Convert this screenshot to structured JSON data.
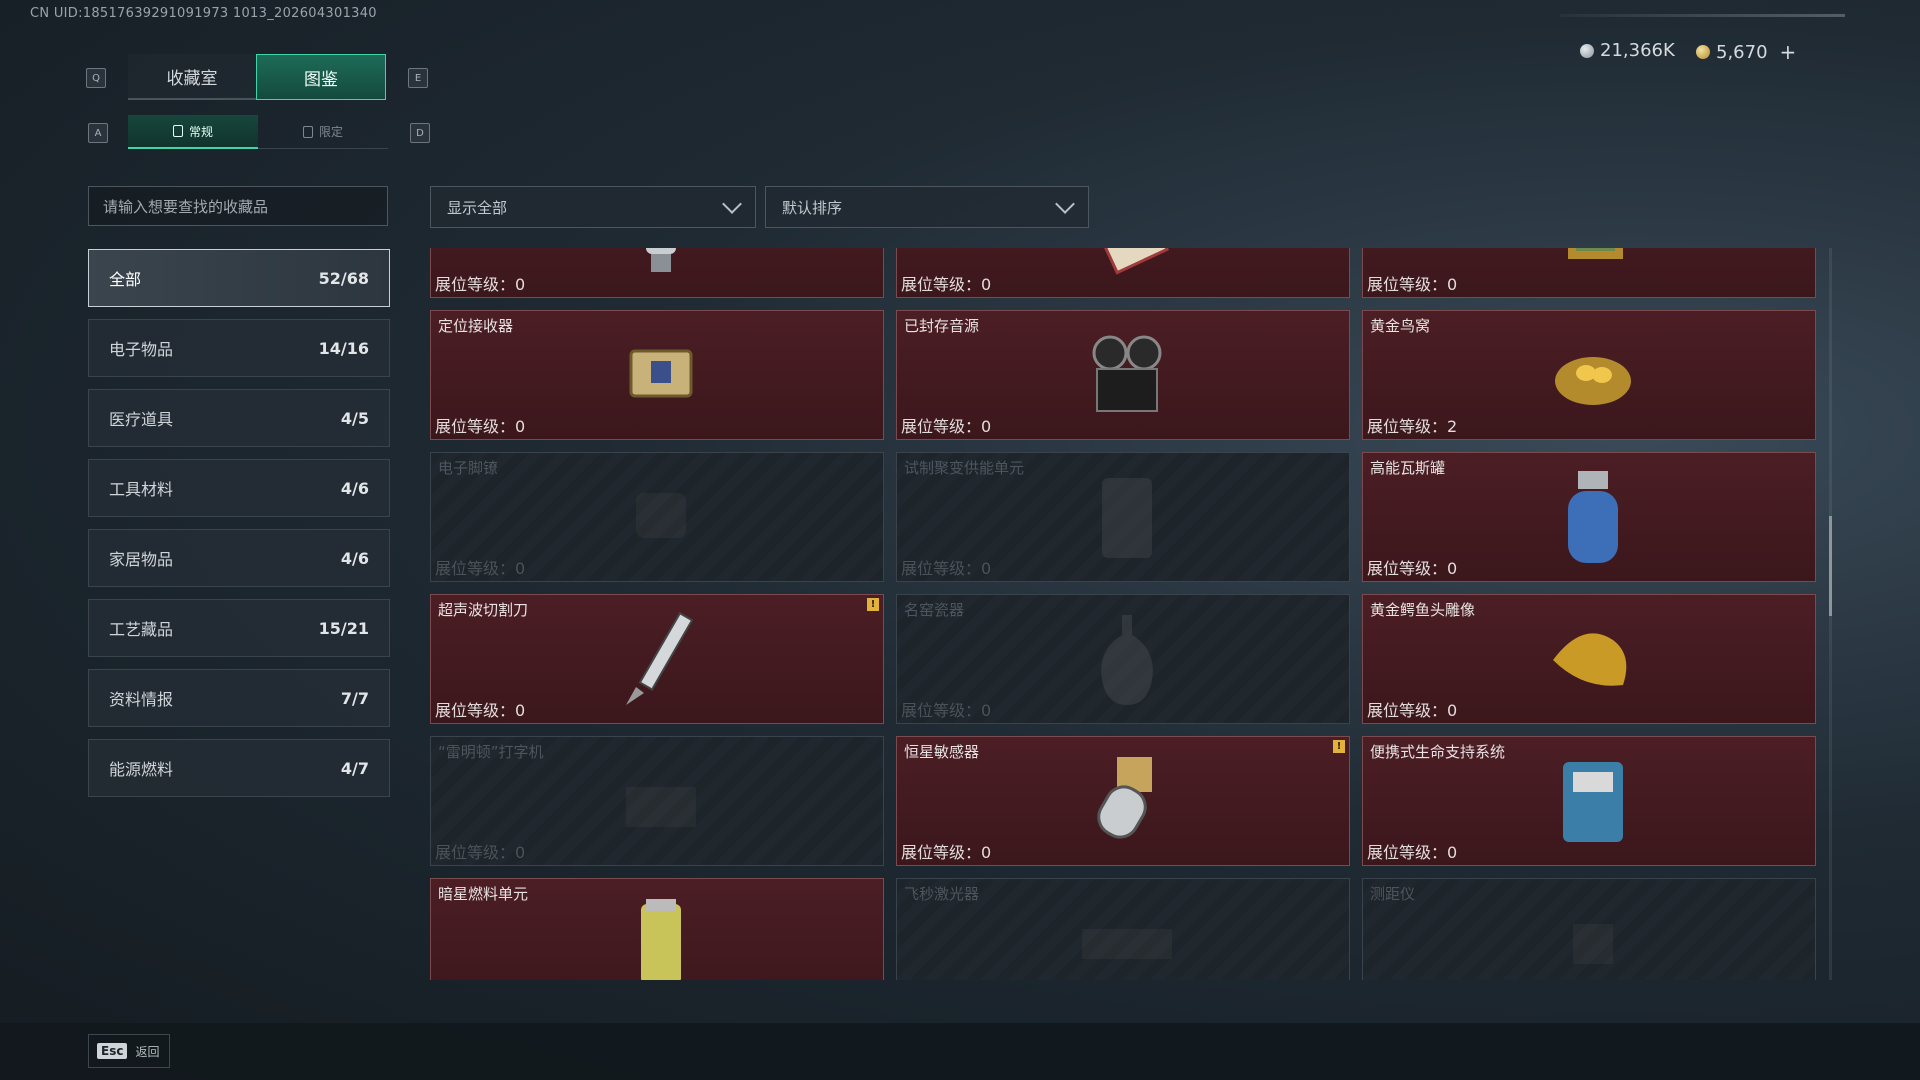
{
  "header": {
    "uid": "CN UID:18517639291091973 1013_202604301340",
    "currency_silver": "21,366K",
    "currency_gold": "5,670",
    "plus_label": "+"
  },
  "keys": {
    "q": "Q",
    "e": "E",
    "a": "A",
    "d": "D"
  },
  "tabs": [
    {
      "label": "收藏室",
      "active": false
    },
    {
      "label": "图鉴",
      "active": true
    }
  ],
  "subtabs": [
    {
      "label": "常规",
      "active": true
    },
    {
      "label": "限定",
      "active": false
    }
  ],
  "search": {
    "placeholder": "请输入想要查找的收藏品"
  },
  "filters": {
    "show": "显示全部",
    "sort": "默认排序"
  },
  "categories": [
    {
      "label": "全部",
      "count": "52/68",
      "active": true
    },
    {
      "label": "电子物品",
      "count": "14/16"
    },
    {
      "label": "医疗道具",
      "count": "4/5"
    },
    {
      "label": "工具材料",
      "count": "4/6"
    },
    {
      "label": "家居物品",
      "count": "4/6"
    },
    {
      "label": "工艺藏品",
      "count": "15/21"
    },
    {
      "label": "资料情报",
      "count": "7/7"
    },
    {
      "label": "能源燃料",
      "count": "4/7"
    }
  ],
  "level_prefix": "展位等级：",
  "items": [
    {
      "name": "",
      "level": "0",
      "unlocked": true,
      "icon": "lock-tool-icon"
    },
    {
      "name": "",
      "level": "0",
      "unlocked": true,
      "icon": "map-scroll-icon"
    },
    {
      "name": "",
      "level": "0",
      "unlocked": true,
      "icon": "framed-painting-icon"
    },
    {
      "name": "定位接收器",
      "level": "0",
      "unlocked": true,
      "icon": "receiver-icon"
    },
    {
      "name": "已封存音源",
      "level": "0",
      "unlocked": true,
      "icon": "reel-recorder-icon"
    },
    {
      "name": "黄金鸟窝",
      "level": "2",
      "unlocked": true,
      "icon": "golden-nest-icon"
    },
    {
      "name": "电子脚镣",
      "level": "0",
      "unlocked": false,
      "icon": "ankle-monitor-icon"
    },
    {
      "name": "试制聚变供能单元",
      "level": "0",
      "unlocked": false,
      "icon": "fusion-unit-icon"
    },
    {
      "name": "高能瓦斯罐",
      "level": "0",
      "unlocked": true,
      "icon": "gas-canister-icon"
    },
    {
      "name": "超声波切割刀",
      "level": "0",
      "unlocked": true,
      "icon": "ultrasonic-knife-icon",
      "badge": "!"
    },
    {
      "name": "名窑瓷器",
      "level": "0",
      "unlocked": false,
      "icon": "porcelain-vase-icon"
    },
    {
      "name": "黄金鳄鱼头雕像",
      "level": "0",
      "unlocked": true,
      "icon": "gold-crocodile-icon"
    },
    {
      "name": "“雷明顿”打字机",
      "level": "0",
      "unlocked": false,
      "icon": "typewriter-icon"
    },
    {
      "name": "恒星敏感器",
      "level": "0",
      "unlocked": true,
      "icon": "star-sensor-icon",
      "badge": "!"
    },
    {
      "name": "便携式生命支持系统",
      "level": "0",
      "unlocked": true,
      "icon": "life-support-icon"
    },
    {
      "name": "暗星燃料单元",
      "level": "",
      "unlocked": true,
      "icon": "fuel-cell-icon"
    },
    {
      "name": "飞秒激光器",
      "level": "",
      "unlocked": false,
      "icon": "laser-icon"
    },
    {
      "name": "测距仪",
      "level": "",
      "unlocked": false,
      "icon": "rangefinder-icon"
    }
  ],
  "footer": {
    "esc_key": "Esc",
    "back_label": "返回"
  }
}
